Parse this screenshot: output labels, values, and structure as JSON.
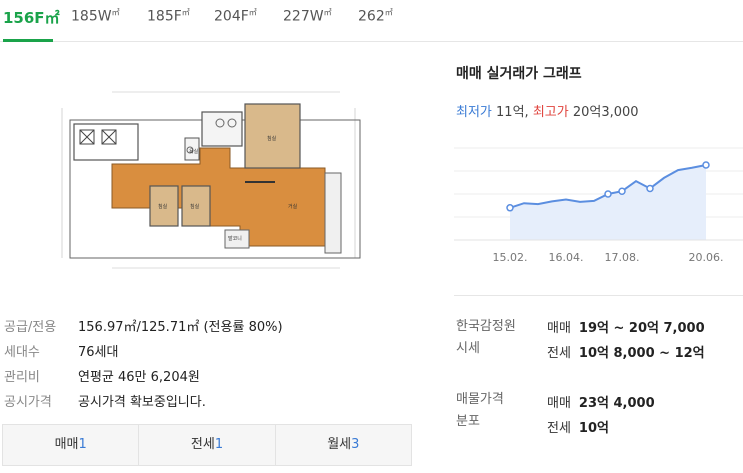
{
  "size_tabs": [
    {
      "label": "156F",
      "active": true
    },
    {
      "label": "185W",
      "active": false
    },
    {
      "label": "185F",
      "active": false
    },
    {
      "label": "204F",
      "active": false
    },
    {
      "label": "227W",
      "active": false
    },
    {
      "label": "262",
      "active": false
    }
  ],
  "unit": "㎡",
  "floorplan": {
    "room_labels": [
      "침실",
      "침실",
      "침실",
      "거실",
      "욕실",
      "발코니"
    ]
  },
  "info": [
    {
      "label": "공급/전용",
      "value": "156.97㎡/125.71㎡ (전용률 80%)"
    },
    {
      "label": "세대수",
      "value": "76세대"
    },
    {
      "label": "관리비",
      "value": "연평균 46만 6,204원"
    },
    {
      "label": "공시가격",
      "value": "공시가격 확보중입니다."
    }
  ],
  "deal_tabs": [
    {
      "label": "매매",
      "count": "1"
    },
    {
      "label": "전세",
      "count": "1"
    },
    {
      "label": "월세",
      "count": "3"
    }
  ],
  "chart_section": {
    "title": "매매 실거래가 그래프",
    "min_label": "최저가",
    "min_value": "11억",
    "max_label": "최고가",
    "max_value": "20억3,000",
    "separator": ","
  },
  "chart_data": {
    "type": "area",
    "x": [
      "15.02.",
      "15.06.",
      "15.10.",
      "16.01.",
      "16.04.",
      "16.08.",
      "16.12.",
      "17.04.",
      "17.08.",
      "17.12.",
      "18.06.",
      "19.01.",
      "19.07.",
      "20.01.",
      "20.06."
    ],
    "values": [
      11.0,
      12.0,
      11.8,
      12.4,
      12.8,
      12.3,
      12.5,
      14.0,
      14.6,
      16.8,
      15.2,
      17.5,
      19.2,
      19.7,
      20.3
    ],
    "tick_labels": [
      "15.02.",
      "16.04.",
      "17.08.",
      "20.06."
    ],
    "ylim": [
      4,
      24
    ],
    "grid": true,
    "color": "#5b8ee0",
    "fill": "#e6eefb"
  },
  "kab": {
    "label_line1": "한국감정원",
    "label_line2": "시세",
    "sale_kind": "매매",
    "sale_value": "19억 ~ 20억 7,000",
    "lease_kind": "전세",
    "lease_value": "10억 8,000 ~ 12억"
  },
  "listing": {
    "label_line1": "매물가격",
    "label_line2": "분포",
    "sale_kind": "매매",
    "sale_value": "23억 4,000",
    "lease_kind": "전세",
    "lease_value": "10억"
  }
}
